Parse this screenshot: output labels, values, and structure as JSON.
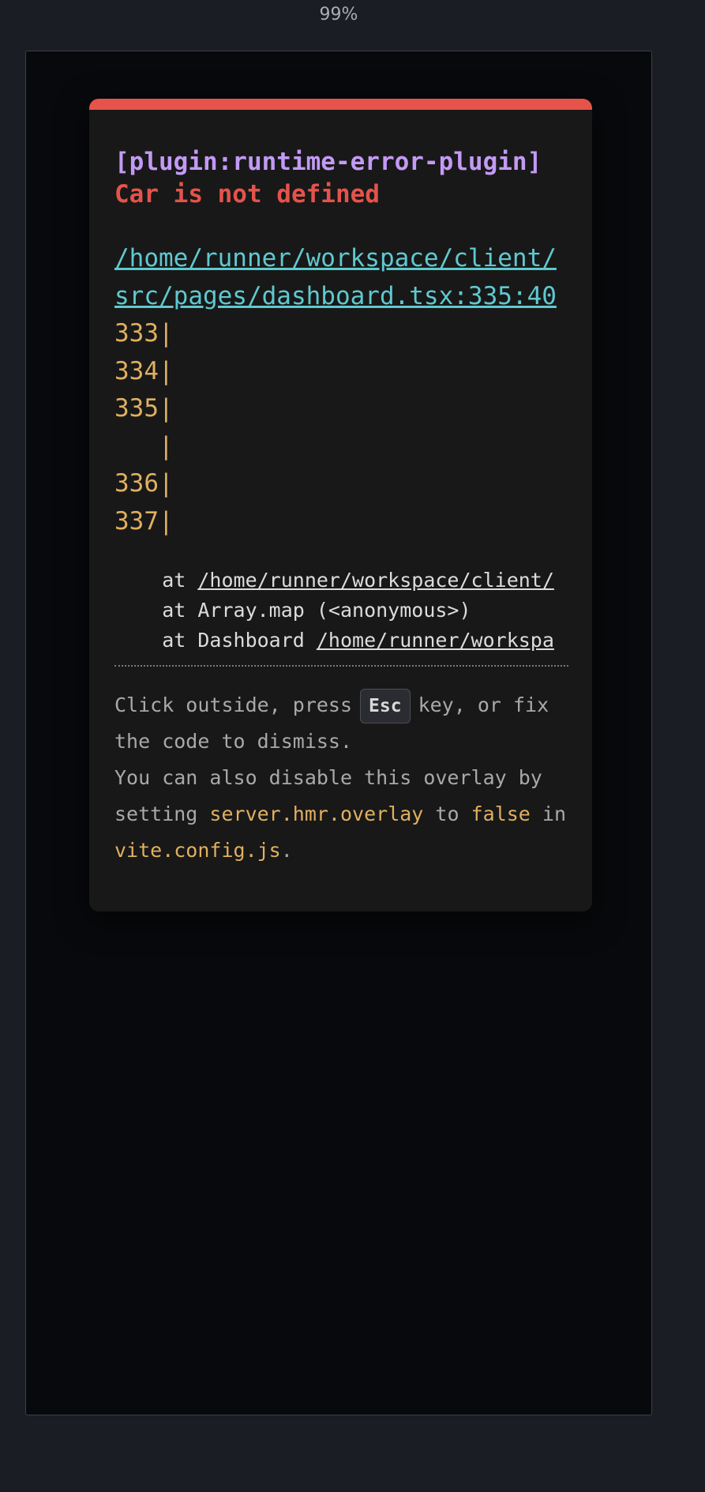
{
  "toolbar": {
    "zoom": "99%"
  },
  "overlay": {
    "plugin": "[plugin:runtime-error-plugin]",
    "message": "Car is not defined",
    "file_link": "/home/runner/workspace/client/src/pages/dashboard.tsx:335:40",
    "code_frame": [
      "333|",
      "334|",
      "335|",
      "   |",
      "336|",
      "337|"
    ],
    "stack": [
      {
        "prefix": "    at ",
        "link": "/home/runner/workspace/client/"
      },
      {
        "prefix": "    at Array.map (<anonymous>)",
        "link": ""
      },
      {
        "prefix": "    at Dashboard ",
        "link": "/home/runner/workspa"
      }
    ],
    "tip": {
      "line1_before": "Click outside, press",
      "key": "Esc",
      "line1_after": "key, or fix the code to dismiss.",
      "line2_before": "You can also disable this overlay by setting",
      "setting": "server.hmr.overlay",
      "line2_mid": "to",
      "value": "false",
      "line2_in": "in",
      "config_file": "vite.config.js",
      "line2_end": "."
    }
  }
}
